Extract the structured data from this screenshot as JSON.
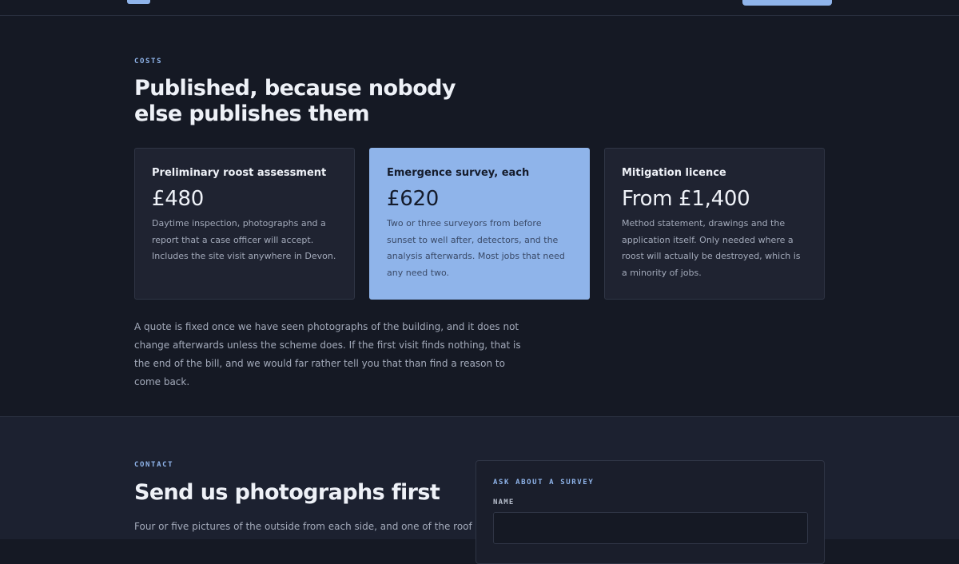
{
  "costs": {
    "eyebrow": "COSTS",
    "heading": "Published, because nobody else publishes them",
    "cards": [
      {
        "title": "Preliminary roost assessment",
        "price": "£480",
        "description": "Daytime inspection, photographs and a report that a case officer will accept. Includes the site visit anywhere in Devon."
      },
      {
        "title": "Emergence survey, each",
        "price": "£620",
        "description": "Two or three surveyors from before sunset to well after, detectors, and the analysis afterwards. Most jobs that need any need two."
      },
      {
        "title": "Mitigation licence",
        "price": "From £1,400",
        "description": "Method statement, drawings and the application itself. Only needed where a roost will actually be destroyed, which is a minority of jobs."
      }
    ],
    "note": "A quote is fixed once we have seen photographs of the building, and it does not change afterwards unless the scheme does. If the first visit finds nothing, that is the end of the bill, and we would far rather tell you that than find a reason to come back."
  },
  "contact": {
    "eyebrow": "CONTACT",
    "heading": "Send us photographs first",
    "lead": "Four or five pictures of the outside from each side, and one of the roof",
    "form": {
      "eyebrow": "ASK ABOUT A SURVEY",
      "name_label": "NAME",
      "name_value": ""
    }
  },
  "colors": {
    "background": "#151924",
    "accent": "#8fb4ea",
    "card": "#1f2331",
    "contact_background": "#1c2130"
  }
}
